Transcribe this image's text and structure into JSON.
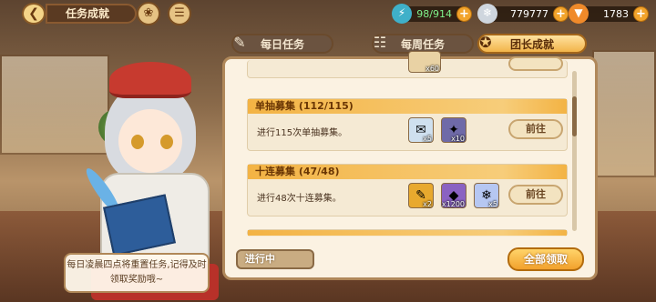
{
  "topbar": {
    "back_icon": "back-arrow-icon",
    "title": "任务成就",
    "resources": [
      {
        "name": "stamina",
        "icon": "stamina-icon",
        "value": "98/914"
      },
      {
        "name": "silver",
        "icon": "coin-icon",
        "value": "779777"
      },
      {
        "name": "carrot",
        "icon": "carrot-icon",
        "value": "1783"
      }
    ]
  },
  "tabs": [
    {
      "label": "每日任务",
      "icon": "quill-icon"
    },
    {
      "label": "每周任务",
      "icon": "scroll-icon"
    },
    {
      "label": "团长成就",
      "icon": "medal-icon",
      "active": true
    }
  ],
  "tasks": [
    {
      "title": "单抽募集 (112/115)",
      "description": "进行115次单抽募集。",
      "rewards": [
        {
          "icon": "letter-icon",
          "count": "x5"
        },
        {
          "icon": "crystal-orb-icon",
          "count": "x10"
        }
      ],
      "button": "前往"
    },
    {
      "title": "十连募集 (47/48)",
      "description": "进行48次十连募集。",
      "rewards": [
        {
          "icon": "ticket-icon",
          "count": "x2"
        },
        {
          "icon": "purple-crystal-icon",
          "count": "x1200"
        },
        {
          "icon": "ice-crystal-icon",
          "count": "x5"
        }
      ],
      "button": "前往"
    }
  ],
  "partial_top": {
    "count": "x60"
  },
  "tip": "每日凌晨四点将重置任务,记得及时领取奖励哦~",
  "footer": {
    "status": "进行中",
    "claim_all": "全部领取"
  },
  "colors": {
    "accent": "#f2a12c",
    "header_gold": "#f3b344",
    "panel": "#fbf2e2"
  }
}
